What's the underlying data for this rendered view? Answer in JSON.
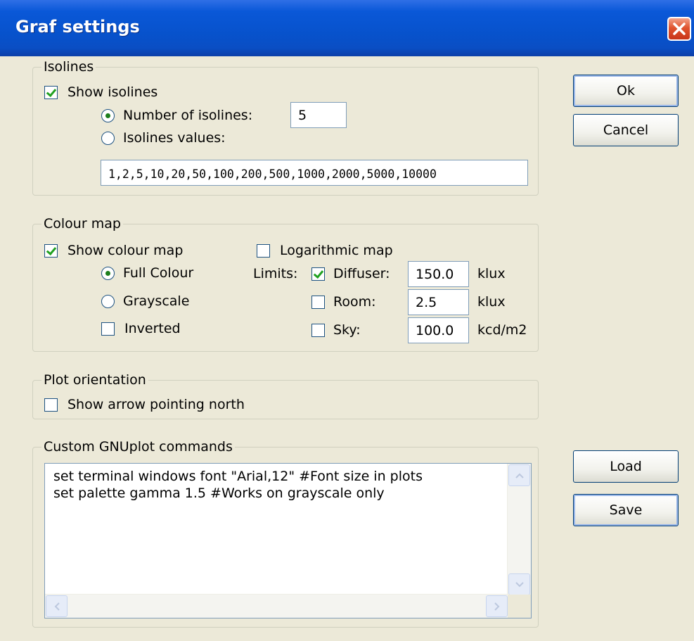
{
  "window": {
    "title": "Graf settings"
  },
  "isolines": {
    "legend": "Isolines",
    "show_label": "Show isolines",
    "show_checked": true,
    "number_label": "Number of isolines:",
    "number_value": "5",
    "values_label": "Isolines values:",
    "values_value": "1,2,5,10,20,50,100,200,500,1000,2000,5000,10000",
    "selected_option": "number"
  },
  "colour_map": {
    "legend": "Colour map",
    "show_label": "Show colour map",
    "show_checked": true,
    "full_colour_label": "Full Colour",
    "grayscale_label": "Grayscale",
    "selected_option": "full_colour",
    "inverted_label": "Inverted",
    "inverted_checked": false,
    "log_label": "Logarithmic map",
    "log_checked": false,
    "limits_label": "Limits:",
    "diffuser_label": "Diffuser:",
    "diffuser_checked": true,
    "diffuser_value": "150.0",
    "diffuser_unit": "klux",
    "room_label": "Room:",
    "room_checked": false,
    "room_value": "2.5",
    "room_unit": "klux",
    "sky_label": "Sky:",
    "sky_checked": false,
    "sky_value": "100.0",
    "sky_unit": "kcd/m2"
  },
  "orientation": {
    "legend": "Plot orientation",
    "north_label": "Show arrow pointing north",
    "north_checked": false
  },
  "gnuplot": {
    "legend": "Custom GNUplot commands",
    "text": "set terminal windows font \"Arial,12\" #Font size in plots\nset palette gamma 1.5 #Works on grayscale only"
  },
  "buttons": {
    "ok": "Ok",
    "cancel": "Cancel",
    "load": "Load",
    "save": "Save"
  },
  "icons": {
    "close": "close-icon",
    "scroll_up": "chevron-up-icon",
    "scroll_down": "chevron-down-icon",
    "scroll_left": "chevron-left-icon",
    "scroll_right": "chevron-right-icon"
  },
  "colors": {
    "title_bar": "#0752cc",
    "dialog_bg": "#ece9d8",
    "close_button": "#e0542f",
    "check_mark": "#21a121"
  }
}
